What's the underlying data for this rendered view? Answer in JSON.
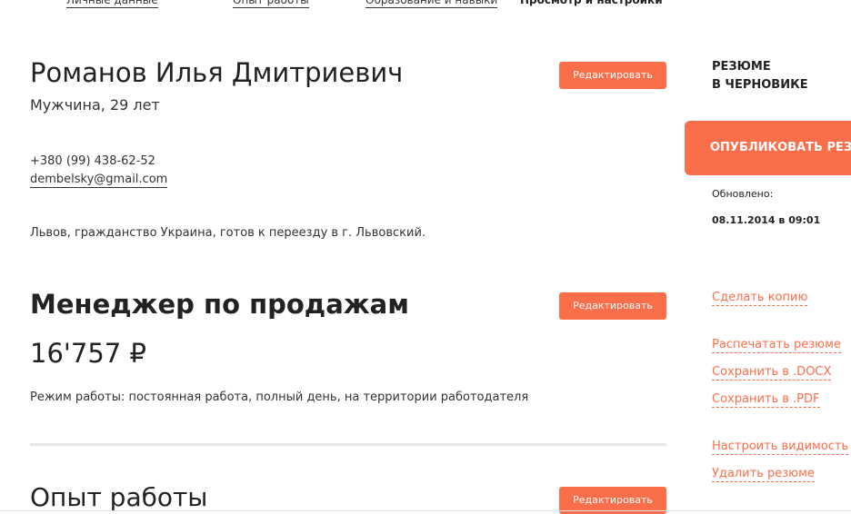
{
  "tabs": [
    {
      "label": "Личные данные"
    },
    {
      "label": "Опыт работы"
    },
    {
      "label": "Образование и навыки"
    },
    {
      "label": "Просмотр и настройки"
    }
  ],
  "personal": {
    "name": "Романов Илья Дмитриевич",
    "gender_age": "Мужчина, 29 лет",
    "phone": "+380 (99) 438-62-52",
    "email": "dembelsky@gmail.com",
    "location": "Львов, гражданство Украина, готов к переезду в г. Львовский."
  },
  "job": {
    "position": "Менеджер по продажам",
    "salary": "16'757 ₽",
    "work_mode": "Режим работы: постоянная работа, полный день, на территории работодателя"
  },
  "experience": {
    "heading": "Опыт работы"
  },
  "edit_label": "Редактировать",
  "sidebar": {
    "status_line1": "РЕЗЮМЕ",
    "status_line2": "В ЧЕРНОВИКЕ",
    "publish_label": "ОПУБЛИКОВАТЬ РЕЗЮМЕ",
    "updated_label": "Обновлено:",
    "updated_date": "08.11.2014 в 09:01",
    "links": [
      {
        "label": "Сделать копию"
      },
      {
        "label": "Распечатать резюме"
      },
      {
        "label": "Сохранить в .DOCX"
      },
      {
        "label": "Сохранить в .PDF"
      },
      {
        "label": "Настроить видимость"
      },
      {
        "label": "Удалить резюме"
      }
    ]
  },
  "colors": {
    "accent": "#fb6e4a",
    "divider": "#e6e6e6"
  }
}
